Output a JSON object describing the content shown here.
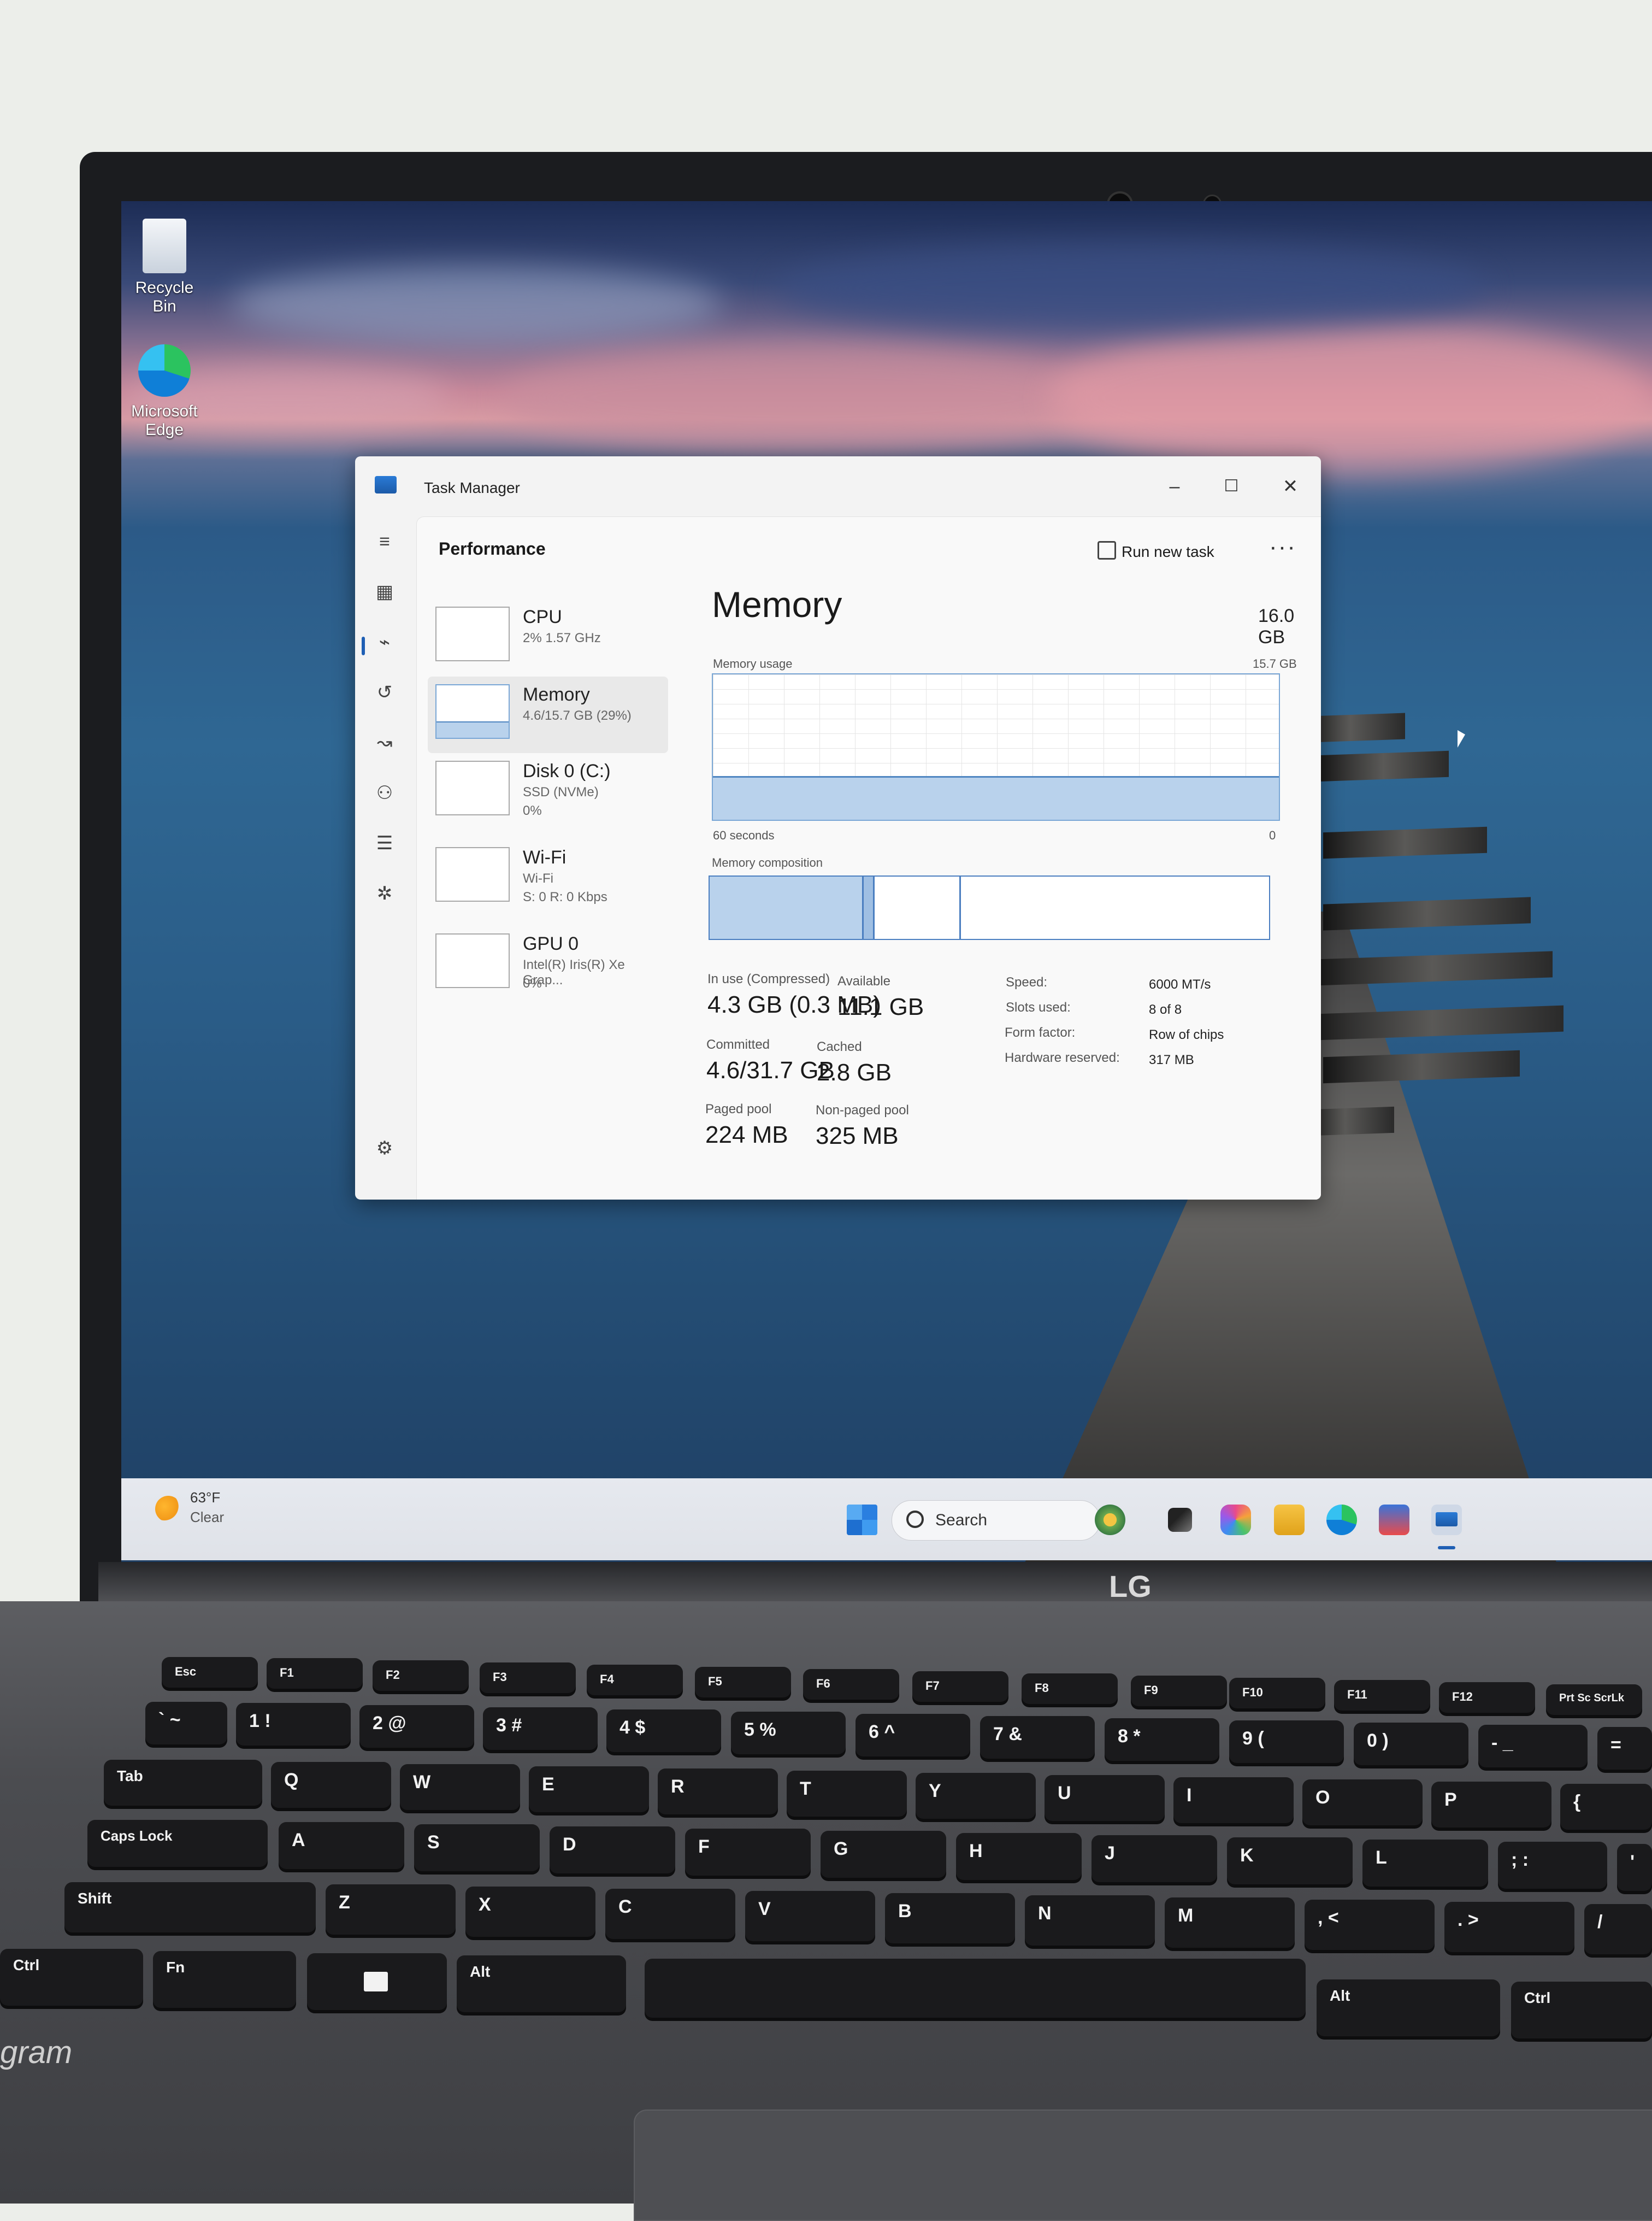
{
  "desktop": {
    "icons": [
      {
        "label": "Recycle Bin"
      },
      {
        "label": "Microsoft Edge"
      }
    ]
  },
  "task_manager": {
    "title": "Task Manager",
    "window_controls": {
      "minimize": "–",
      "maximize": "☐",
      "close": "✕"
    },
    "section_title": "Performance",
    "run_new_task": "Run new task",
    "more": "···",
    "sidebar": [
      {
        "name": "CPU",
        "line1": "2%  1.57 GHz",
        "line2": ""
      },
      {
        "name": "Memory",
        "line1": "4.6/15.7 GB (29%)",
        "line2": ""
      },
      {
        "name": "Disk 0 (C:)",
        "line1": "SSD (NVMe)",
        "line2": "0%"
      },
      {
        "name": "Wi-Fi",
        "line1": "Wi-Fi",
        "line2": "S: 0  R: 0 Kbps"
      },
      {
        "name": "GPU 0",
        "line1": "Intel(R) Iris(R) Xe Grap...",
        "line2": "0%"
      }
    ],
    "memory": {
      "title": "Memory",
      "total": "16.0 GB",
      "usage_label": "Memory usage",
      "usage_max": "15.7 GB",
      "time_label": "60 seconds",
      "zero_label": "0",
      "usage_fraction": 0.29,
      "composition_label": "Memory composition",
      "stats": {
        "in_use_label": "In use (Compressed)",
        "in_use": "4.3 GB (0.3 MB)",
        "available_label": "Available",
        "available": "11.1 GB",
        "committed_label": "Committed",
        "committed": "4.6/31.7 GB",
        "cached_label": "Cached",
        "cached": "2.8 GB",
        "paged_label": "Paged pool",
        "paged": "224 MB",
        "nonpaged_label": "Non-paged pool",
        "nonpaged": "325 MB"
      },
      "specs": [
        {
          "label": "Speed:",
          "value": "6000 MT/s"
        },
        {
          "label": "Slots used:",
          "value": "8 of 8"
        },
        {
          "label": "Form factor:",
          "value": "Row of chips"
        },
        {
          "label": "Hardware reserved:",
          "value": "317 MB"
        }
      ]
    }
  },
  "taskbar": {
    "weather_temp": "63°F",
    "weather_condition": "Clear",
    "search_label": "Search"
  },
  "laptop": {
    "brand": "LG",
    "model": "gram"
  },
  "keyboard": {
    "row_fn": [
      "Esc",
      "F1",
      "F2",
      "F3",
      "F4",
      "F5",
      "F6",
      "F7",
      "F8",
      "F9",
      "F10",
      "F11",
      "F12",
      "Prt Sc ScrLk"
    ],
    "row_num": [
      "` ~",
      "1 !",
      "2 @",
      "3 #",
      "4 $",
      "5 %",
      "6 ^",
      "7 &",
      "8 *",
      "9 (",
      "0 )",
      "- _",
      "="
    ],
    "row_q": [
      "Tab",
      "Q",
      "W",
      "E",
      "R",
      "T",
      "Y",
      "U",
      "I",
      "O",
      "P",
      "{"
    ],
    "row_a": [
      "Caps Lock",
      "A",
      "S",
      "D",
      "F",
      "G",
      "H",
      "J",
      "K",
      "L",
      "; :",
      "'"
    ],
    "row_z": [
      "Shift",
      "Z",
      "X",
      "C",
      "V",
      "B",
      "N",
      "M",
      ", <",
      ". >",
      "/"
    ],
    "row_bottom": [
      "Ctrl",
      "Fn",
      "",
      "Alt",
      "",
      "Alt",
      "Ctrl"
    ]
  },
  "colors": {
    "accent": "#4f86c1",
    "graph_fill": "#b9d2ec"
  }
}
